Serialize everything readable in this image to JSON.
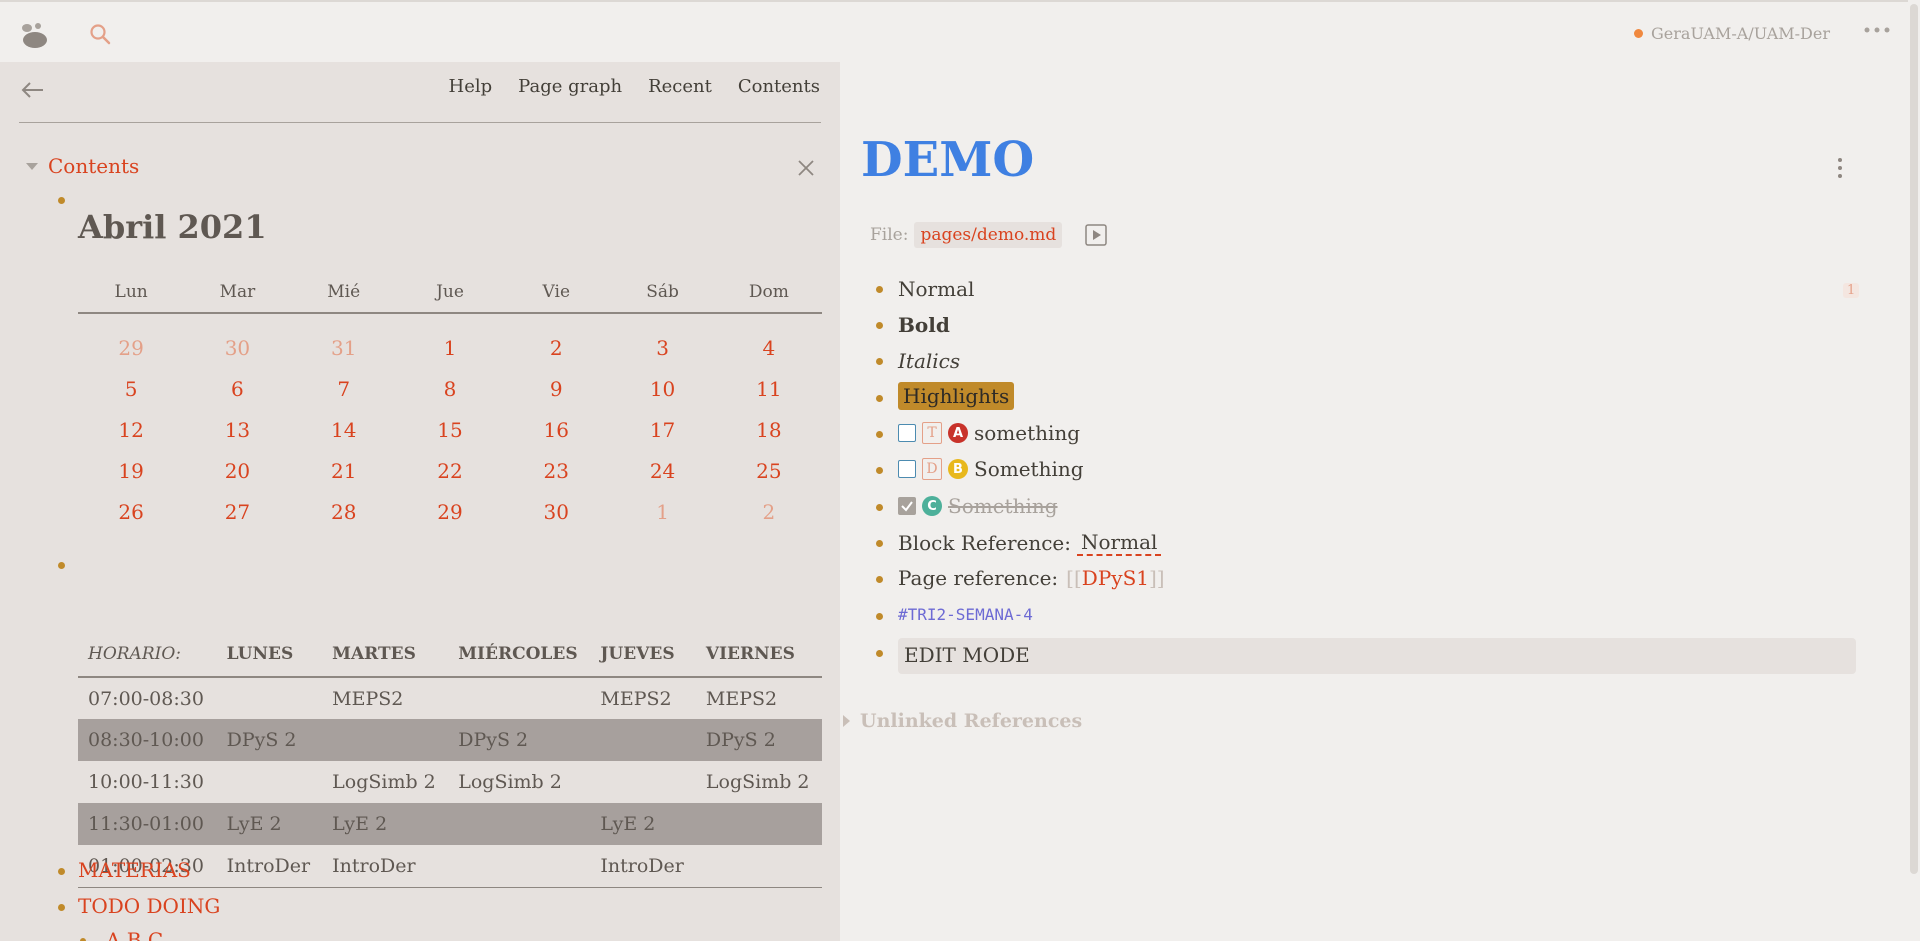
{
  "header": {
    "repo": "GeraUAM-A/UAM-Der",
    "accent": "#d9431f",
    "icons": [
      "logseq-logo-icon",
      "search-icon",
      "more-icon"
    ]
  },
  "sidebar": {
    "nav": [
      "Help",
      "Page graph",
      "Recent",
      "Contents"
    ],
    "contents_title": "Contents",
    "calendar": {
      "title": "Abril 2021",
      "weekdays": [
        "Lun",
        "Mar",
        "Mié",
        "Jue",
        "Vie",
        "Sáb",
        "Dom"
      ],
      "days": [
        {
          "d": "29",
          "dim": true
        },
        {
          "d": "30",
          "dim": true
        },
        {
          "d": "31",
          "dim": true
        },
        {
          "d": "1"
        },
        {
          "d": "2"
        },
        {
          "d": "3"
        },
        {
          "d": "4"
        },
        {
          "d": "5"
        },
        {
          "d": "6"
        },
        {
          "d": "7"
        },
        {
          "d": "8"
        },
        {
          "d": "9"
        },
        {
          "d": "10"
        },
        {
          "d": "11"
        },
        {
          "d": "12"
        },
        {
          "d": "13"
        },
        {
          "d": "14"
        },
        {
          "d": "15"
        },
        {
          "d": "16"
        },
        {
          "d": "17"
        },
        {
          "d": "18"
        },
        {
          "d": "19"
        },
        {
          "d": "20"
        },
        {
          "d": "21"
        },
        {
          "d": "22"
        },
        {
          "d": "23"
        },
        {
          "d": "24"
        },
        {
          "d": "25"
        },
        {
          "d": "26"
        },
        {
          "d": "27"
        },
        {
          "d": "28"
        },
        {
          "d": "29"
        },
        {
          "d": "30"
        },
        {
          "d": "1",
          "dim": true
        },
        {
          "d": "2",
          "dim": true
        }
      ]
    },
    "schedule": {
      "headers": [
        "HORARIO:",
        "LUNES",
        "MARTES",
        "MIÉRCOLES",
        "JUEVES",
        "VIERNES"
      ],
      "rows": [
        {
          "shade": false,
          "cells": [
            "07:00-08:30",
            "",
            "MEPS2",
            "",
            "MEPS2",
            "MEPS2"
          ]
        },
        {
          "shade": true,
          "cells": [
            "08:30-10:00",
            "DPyS 2",
            "",
            "DPyS 2",
            "",
            "DPyS 2"
          ]
        },
        {
          "shade": false,
          "cells": [
            "10:00-11:30",
            "",
            "LogSimb 2",
            "LogSimb 2",
            "",
            "LogSimb 2"
          ]
        },
        {
          "shade": true,
          "cells": [
            "11:30-01:00",
            "LyE 2",
            "LyE 2",
            "",
            "LyE 2",
            ""
          ]
        },
        {
          "shade": false,
          "cells": [
            "01:00-02:30",
            "IntroDer",
            "IntroDer",
            "",
            "IntroDer",
            ""
          ]
        }
      ]
    },
    "links": [
      "MATERIAS",
      "TODO DOING",
      "A B C"
    ]
  },
  "page": {
    "title": "DEMO",
    "file_label": "File:",
    "file_path": "pages/demo.md",
    "ref_count": "1",
    "blocks": {
      "normal": "Normal",
      "bold": "Bold",
      "italics": "Italics",
      "highlights": "Highlights",
      "todo1_marker": "T",
      "todo1_priority": "A",
      "todo1_text": "something",
      "todo2_marker": "D",
      "todo2_priority": "B",
      "todo2_text": "Something",
      "done_priority": "C",
      "done_text": "Something",
      "block_ref_label": "Block Reference:",
      "block_ref_value": "Normal",
      "page_ref_label": "Page reference:",
      "page_ref_open": "[[",
      "page_ref_value": "DPyS1",
      "page_ref_close": "]]",
      "tag": "#TRI2-SEMANA-4",
      "edit_mode": "EDIT MODE"
    },
    "unlinked": "Unlinked References"
  }
}
